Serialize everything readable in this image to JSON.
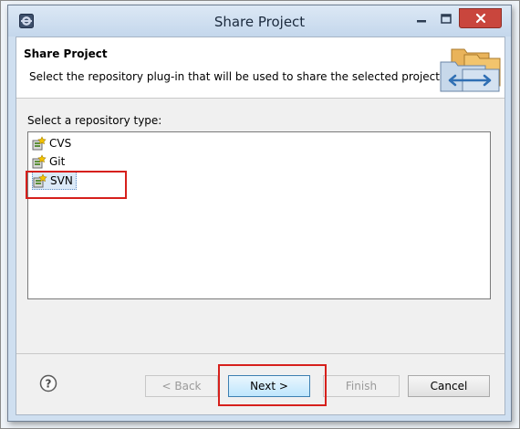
{
  "window": {
    "title": "Share Project"
  },
  "header": {
    "title": "Share Project",
    "description": "Select the repository plug-in that will be used to share the selected project."
  },
  "repository": {
    "label": "Select a repository type:",
    "items": [
      {
        "label": "CVS",
        "selected": false
      },
      {
        "label": "Git",
        "selected": false
      },
      {
        "label": "SVN",
        "selected": true
      }
    ]
  },
  "buttons": {
    "back": "< Back",
    "next": "Next >",
    "finish": "Finish",
    "cancel": "Cancel"
  },
  "icons": {
    "app": "eclipse-icon",
    "help": "help-icon",
    "repo": "repository-icon",
    "header": "share-folders-icon"
  },
  "colors": {
    "highlight": "#d6201c",
    "close_button": "#c9463d",
    "selection": "#dbe9f7"
  }
}
